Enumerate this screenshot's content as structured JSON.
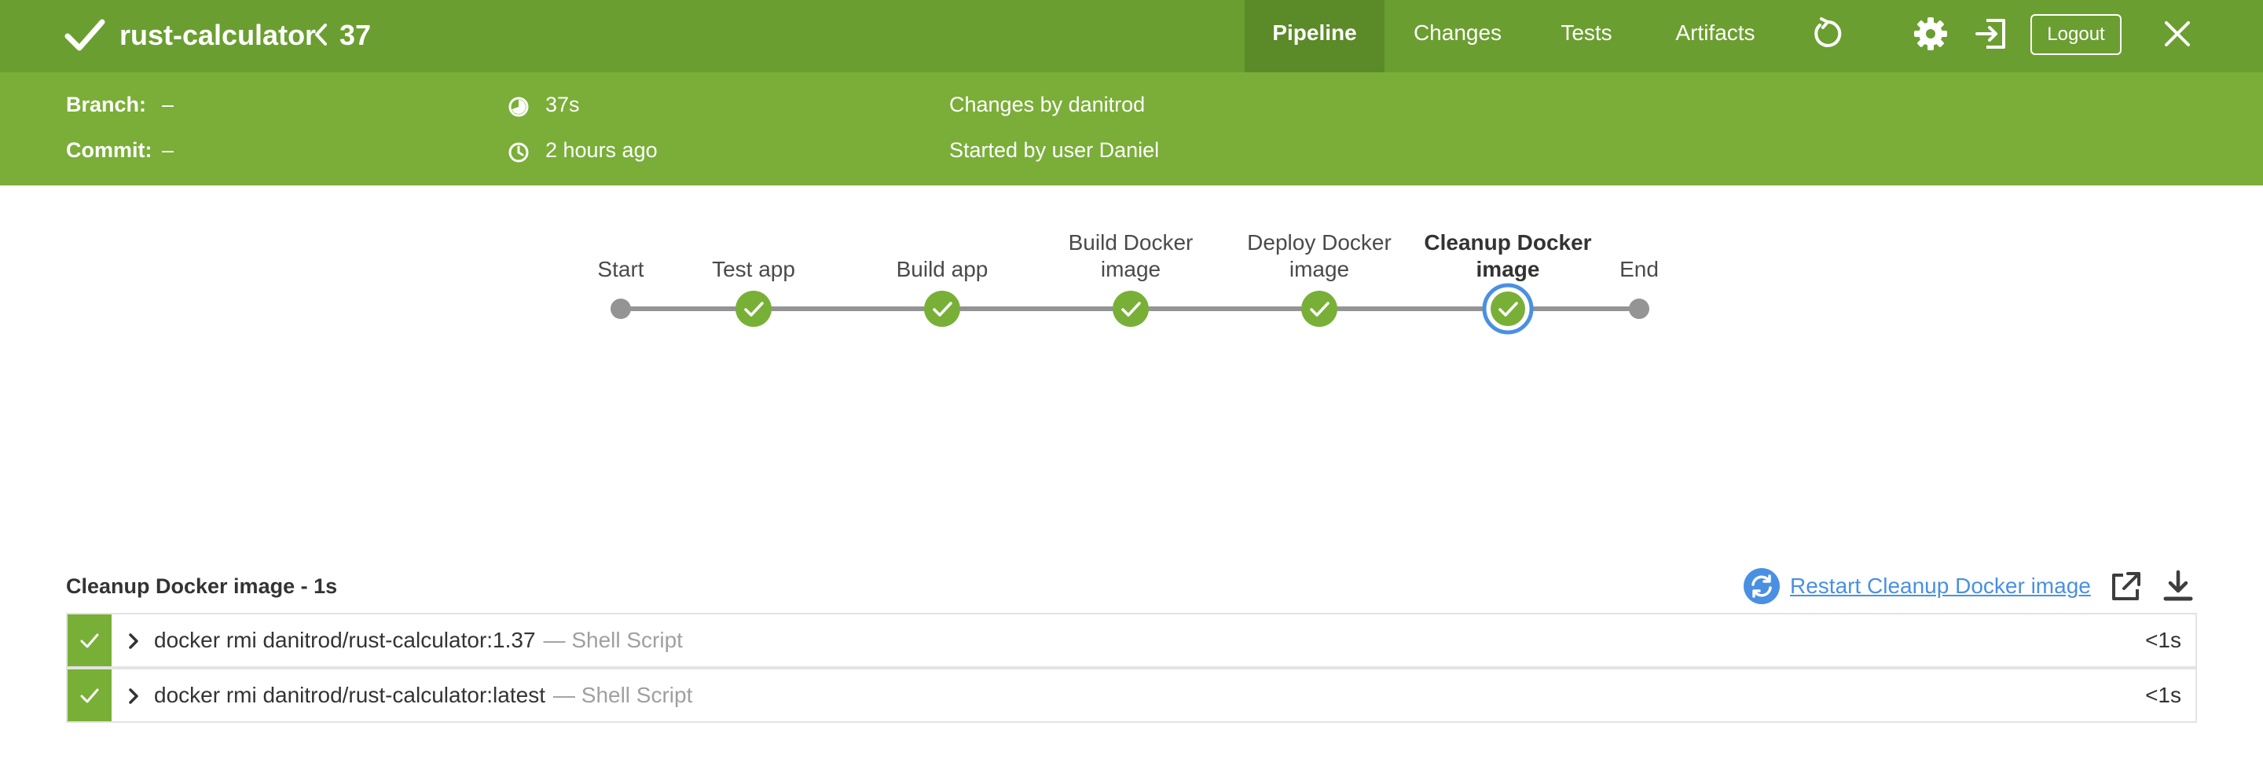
{
  "header": {
    "job_name": "rust-calculator",
    "run_number": "37",
    "tabs": [
      {
        "label": "Pipeline",
        "active": true
      },
      {
        "label": "Changes",
        "active": false
      },
      {
        "label": "Tests",
        "active": false
      },
      {
        "label": "Artifacts",
        "active": false
      }
    ],
    "logout_label": "Logout",
    "icons": [
      "check-icon",
      "chevron-left-icon",
      "replay-icon",
      "gear-icon",
      "sign-out-icon",
      "close-icon"
    ]
  },
  "info": {
    "branch_label": "Branch:",
    "branch_value": "–",
    "commit_label": "Commit:",
    "commit_value": "–",
    "duration": "37s",
    "started_ago": "2 hours ago",
    "changes_by": "Changes by danitrod",
    "started_by": "Started by user Daniel"
  },
  "pipeline": {
    "stages": [
      {
        "name": "Start",
        "status": "terminal"
      },
      {
        "name": "Test app",
        "status": "success"
      },
      {
        "name": "Build app",
        "status": "success"
      },
      {
        "name": "Build Docker image",
        "status": "success"
      },
      {
        "name": "Deploy Docker image",
        "status": "success"
      },
      {
        "name": "Cleanup Docker image",
        "status": "success",
        "selected": true
      },
      {
        "name": "End",
        "status": "terminal"
      }
    ]
  },
  "log": {
    "title": "Cleanup Docker image - 1s",
    "restart_label": "Restart Cleanup Docker image",
    "steps": [
      {
        "command": "docker rmi danitrod/rust-calculator:1.37",
        "type": "— Shell Script",
        "duration": "<1s",
        "status": "success"
      },
      {
        "command": "docker rmi danitrod/rust-calculator:latest",
        "type": "— Shell Script",
        "duration": "<1s",
        "status": "success"
      }
    ]
  },
  "colors": {
    "header": "#6b9e30",
    "infobar": "#7aae38",
    "active_tab": "#5b8a28",
    "success": "#78b037",
    "terminal_node": "#949494",
    "link": "#4a90e2"
  }
}
